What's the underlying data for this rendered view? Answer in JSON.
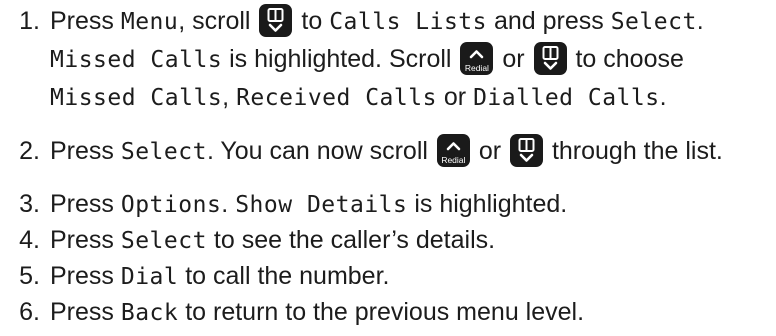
{
  "colors": {
    "text": "#1c1c1c",
    "button_fill": "#1a1a1a",
    "button_icon": "#ffffff"
  },
  "icons": {
    "scroll_down_book": "phonebook-down-icon",
    "scroll_up_redial": "redial-up-icon"
  },
  "steps": [
    {
      "number": "1.",
      "line1": {
        "t1": "Press ",
        "menu": "Menu",
        "t2": ", scroll ",
        "t3": " to ",
        "calls_lists": "Calls Lists",
        "t4": " and press ",
        "select": "Select",
        "t5": "."
      },
      "line2": {
        "missed": "Missed Calls",
        "t1": " is highlighted. Scroll ",
        "t2": " or ",
        "t3": " to choose"
      },
      "line3": {
        "missed": "Missed Calls",
        "sep1": ", ",
        "received": "Received Calls",
        "t1": " or ",
        "dialled": "Dialled Calls",
        "t2": "."
      }
    },
    {
      "number": "2.",
      "line1": {
        "t1": "Press ",
        "select": "Select",
        "t2": ". You can now scroll ",
        "t3": " or ",
        "t4": " through the list."
      }
    },
    {
      "number": "3.",
      "line1": {
        "t1": "Press ",
        "options": "Options",
        "t2": ". ",
        "show_details": "Show Details",
        "t3": " is highlighted."
      }
    },
    {
      "number": "4.",
      "line1": {
        "t1": "Press ",
        "select": "Select",
        "t2": " to see the caller’s details."
      }
    },
    {
      "number": "5.",
      "line1": {
        "t1": "Press ",
        "dial": "Dial",
        "t2": " to call the number."
      }
    },
    {
      "number": "6.",
      "line1": {
        "t1": "Press ",
        "back": "Back",
        "t2": " to return to the previous menu level."
      }
    }
  ],
  "buttons": {
    "redial_label": "Redial"
  }
}
